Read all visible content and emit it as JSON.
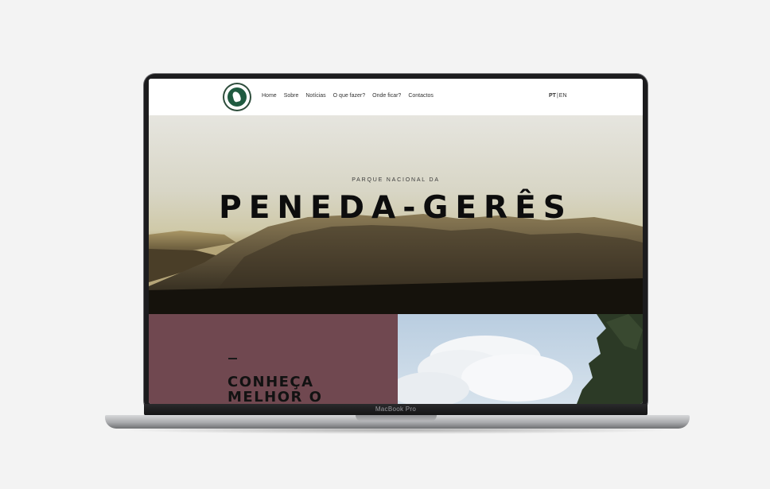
{
  "site": {
    "nav": [
      "Home",
      "Sobre",
      "Notícias",
      "O que fazer?",
      "Onde ficar?",
      "Contactos"
    ],
    "lang": {
      "pt": "PT",
      "sep": "|",
      "en": "EN"
    }
  },
  "hero": {
    "subtitle": "PARQUE NACIONAL DA",
    "title": "PENEDA-GERÊS"
  },
  "section": {
    "title_line1": "CONHEÇA",
    "title_line2": "MELHOR O"
  },
  "device": {
    "label": "MacBook Pro"
  },
  "colors": {
    "background": "#f3f3f3",
    "maroon": "#704850",
    "logo_green": "#1f5a40"
  }
}
